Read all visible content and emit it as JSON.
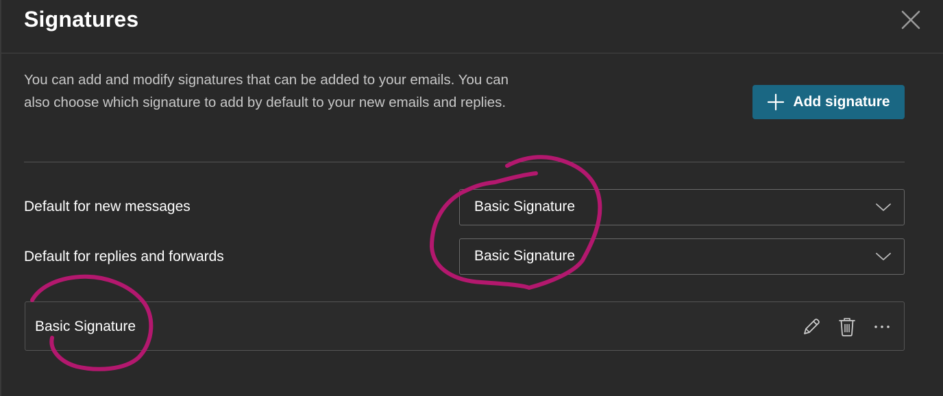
{
  "dialog": {
    "title": "Signatures",
    "description": "You can add and modify signatures that can be added to your emails. You can also choose which signature to add by default to your new emails and replies.",
    "add_button": {
      "label": "Add signature",
      "icon": "plus-icon"
    },
    "close_icon": "close-icon"
  },
  "defaults": {
    "new_messages": {
      "label": "Default for new messages",
      "value": "Basic Signature"
    },
    "replies_forwards": {
      "label": "Default for replies and forwards",
      "value": "Basic Signature"
    }
  },
  "signatures": [
    {
      "name": "Basic Signature",
      "actions": [
        "edit-icon",
        "delete-icon",
        "more-icon"
      ]
    }
  ],
  "colors": {
    "background": "#292929",
    "accent_button": "#1a6783",
    "annotation": "#b3186e"
  }
}
